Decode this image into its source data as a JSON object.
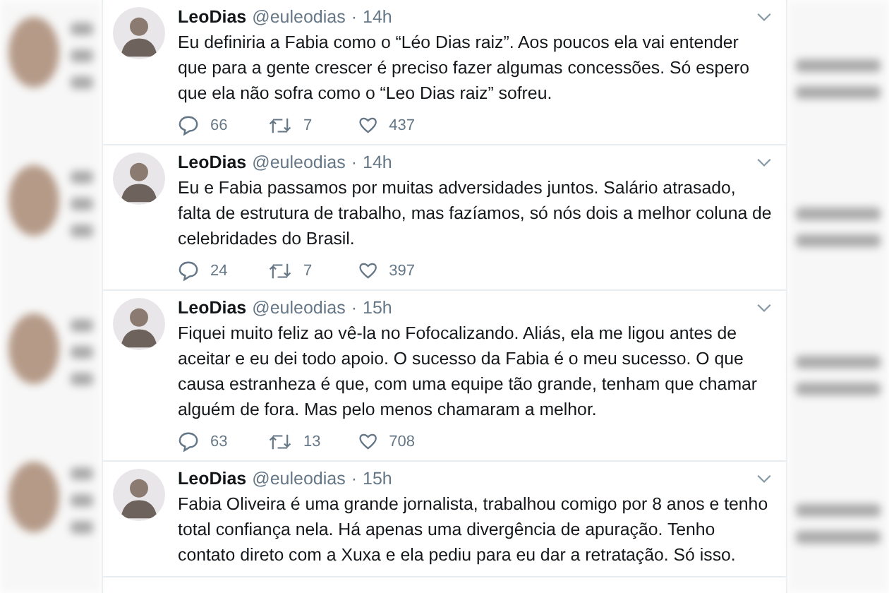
{
  "tweets": [
    {
      "name": "LeoDias",
      "handle": "@euleodias",
      "separator": "·",
      "time": "14h",
      "text": "Eu definiria a Fabia como o “Léo Dias raiz”. Aos poucos ela vai entender que para a gente crescer é preciso fazer algumas concessões. Só espero que ela não sofra como o “Leo Dias raiz” sofreu.",
      "replies": "66",
      "retweets": "7",
      "likes": "437"
    },
    {
      "name": "LeoDias",
      "handle": "@euleodias",
      "separator": "·",
      "time": "14h",
      "text": "Eu e Fabia passamos por muitas adversidades juntos. Salário atrasado, falta de estrutura de trabalho, mas fazíamos, só nós dois a melhor coluna de celebridades do Brasil.",
      "replies": "24",
      "retweets": "7",
      "likes": "397"
    },
    {
      "name": "LeoDias",
      "handle": "@euleodias",
      "separator": "·",
      "time": "15h",
      "text": "Fiquei muito feliz ao vê-la no Fofocalizando. Aliás, ela me ligou antes de aceitar e eu dei todo apoio. O sucesso da Fabia é o meu sucesso. O que causa estranheza é que, com uma equipe tão grande, tenham que chamar alguém de fora. Mas pelo menos chamaram a melhor.",
      "replies": "63",
      "retweets": "13",
      "likes": "708"
    },
    {
      "name": "LeoDias",
      "handle": "@euleodias",
      "separator": "·",
      "time": "15h",
      "text": "Fabia Oliveira é uma grande jornalista, trabalhou comigo por 8 anos e tenho total confiança nela. Há apenas uma divergência de apuração. Tenho contato direto com a Xuxa e ela pediu para eu dar a retratação. Só isso."
    }
  ]
}
